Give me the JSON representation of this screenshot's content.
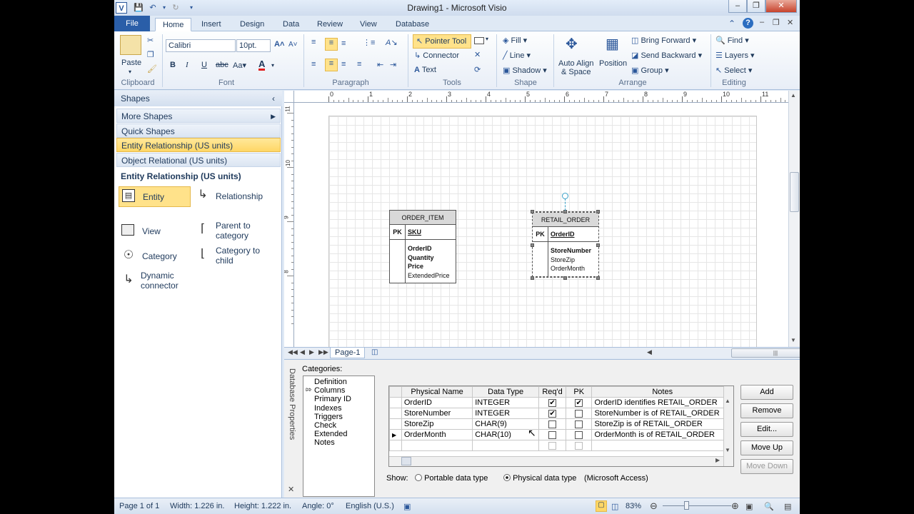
{
  "app": {
    "title": "Drawing1 - Microsoft Visio",
    "app_icon_label": "V"
  },
  "tabs": [
    "File",
    "Home",
    "Insert",
    "Design",
    "Data",
    "Review",
    "View",
    "Database"
  ],
  "ribbon": {
    "clipboard": {
      "paste": "Paste",
      "label": "Clipboard"
    },
    "font": {
      "name": "Calibri",
      "size": "10pt.",
      "label": "Font"
    },
    "paragraph": {
      "label": "Paragraph"
    },
    "tools": {
      "pointer": "Pointer Tool",
      "connector": "Connector",
      "text": "Text",
      "label": "Tools"
    },
    "shape": {
      "fill": "Fill",
      "line": "Line",
      "shadow": "Shadow",
      "label": "Shape"
    },
    "arrange": {
      "auto_align_line1": "Auto Align",
      "auto_align_line2": "& Space",
      "position": "Position",
      "bring_forward": "Bring Forward",
      "send_backward": "Send Backward",
      "group": "Group",
      "label": "Arrange"
    },
    "editing": {
      "find": "Find",
      "layers": "Layers",
      "select": "Select",
      "label": "Editing"
    }
  },
  "shapes_pane": {
    "title": "Shapes",
    "stencils": [
      "More Shapes",
      "Quick Shapes",
      "Entity Relationship (US units)",
      "Object Relational (US units)"
    ],
    "section_title": "Entity Relationship (US units)",
    "items": {
      "entity": "Entity",
      "relationship": "Relationship",
      "view": "View",
      "parent_to_category": [
        "Parent to",
        "category"
      ],
      "category": "Category",
      "category_to_child": [
        "Category to",
        "child"
      ],
      "dynamic_connector": [
        "Dynamic",
        "connector"
      ]
    }
  },
  "ruler": {
    "h_ticks": [
      "0",
      "1",
      "2",
      "3",
      "4",
      "5",
      "6",
      "7",
      "8",
      "9",
      "10",
      "11"
    ],
    "v_ticks": [
      "11",
      "10",
      "9",
      "8"
    ]
  },
  "entities": {
    "order_item": {
      "name": "ORDER_ITEM",
      "pk_label": "PK",
      "pk": "SKU",
      "attrs": [
        {
          "text": "OrderID",
          "bold": true
        },
        {
          "text": "Quantity",
          "bold": true
        },
        {
          "text": "Price",
          "bold": true
        },
        {
          "text": "ExtendedPrice",
          "bold": false
        }
      ]
    },
    "retail_order": {
      "name": "RETAIL_ORDER",
      "pk_label": "PK",
      "pk": "OrderID",
      "attrs": [
        {
          "text": "StoreNumber",
          "bold": true
        },
        {
          "text": "StoreZip",
          "bold": false
        },
        {
          "text": "OrderMonth",
          "bold": false
        }
      ]
    }
  },
  "page_tab": "Page-1",
  "db_properties": {
    "title": "Database Properties",
    "categories_label": "Categories:",
    "categories": [
      "Definition",
      "Columns",
      "Primary ID",
      "Indexes",
      "Triggers",
      "Check",
      "Extended",
      "Notes"
    ],
    "selected_category": "Columns",
    "columns": [
      "Physical Name",
      "Data Type",
      "Req'd",
      "PK",
      "Notes"
    ],
    "rows": [
      {
        "name": "OrderID",
        "type": "INTEGER",
        "reqd": true,
        "pk": true,
        "notes": "OrderID identifies RETAIL_ORDER"
      },
      {
        "name": "StoreNumber",
        "type": "INTEGER",
        "reqd": true,
        "pk": false,
        "notes": "StoreNumber is of RETAIL_ORDER"
      },
      {
        "name": "StoreZip",
        "type": "CHAR(9)",
        "reqd": false,
        "pk": false,
        "notes": "StoreZip is of RETAIL_ORDER"
      },
      {
        "name": "OrderMonth",
        "type": "CHAR(10)",
        "reqd": false,
        "pk": false,
        "notes": "OrderMonth is of RETAIL_ORDER"
      }
    ],
    "buttons": [
      "Add",
      "Remove",
      "Edit...",
      "Move Up",
      "Move Down"
    ],
    "show_label": "Show:",
    "portable": "Portable data type",
    "physical": "Physical data type",
    "db_name": "(Microsoft Access)"
  },
  "status": {
    "page": "Page 1 of 1",
    "width": "Width: 1.226 in.",
    "height": "Height: 1.222 in.",
    "angle": "Angle: 0°",
    "language": "English (U.S.)",
    "zoom": "83%"
  },
  "colors": {
    "file_tab": "#2a5ea8",
    "highlight": "#ffd766",
    "ribbon_bg": "#e8eef7"
  }
}
